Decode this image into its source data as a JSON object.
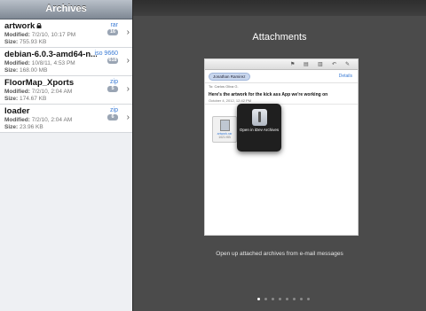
{
  "sidebar": {
    "title": "Archives",
    "items": [
      {
        "name": "artwork",
        "locked": true,
        "type": "rar",
        "badge": "16",
        "modified_label": "Modified:",
        "modified": "7/2/10, 10:17 PM",
        "size_label": "Size:",
        "size": "755.93 KB"
      },
      {
        "name": "debian-6.0.3-amd64-n...",
        "locked": false,
        "type": "iso 9660",
        "badge": "618",
        "modified_label": "Modified:",
        "modified": "10/8/11, 4:53 PM",
        "size_label": "Size:",
        "size": "168.00 MB"
      },
      {
        "name": "FloorMap_Xports",
        "locked": false,
        "type": "zip",
        "badge": "5",
        "modified_label": "Modified:",
        "modified": "7/2/10, 2:04 AM",
        "size_label": "Size:",
        "size": "174.67 KB"
      },
      {
        "name": "loader",
        "locked": false,
        "type": "zip",
        "badge": "6",
        "modified_label": "Modified:",
        "modified": "7/2/10, 2:04 AM",
        "size_label": "Size:",
        "size": "23.96 KB"
      }
    ]
  },
  "main": {
    "title": "Attachments",
    "caption": "Open up attached archives from e-mail messages",
    "page_count": 8,
    "current_page": 1
  },
  "email": {
    "recipient": "Jonathan Ramirez",
    "details": "Details",
    "cc": "To: Carlos Oliva G.",
    "subject": "Here's the artwork for the kick ass App we're working on",
    "date": "October 4, 2012, 12:42 PM",
    "attachment_name": "artwork.rar",
    "attachment_size": "1021 KB",
    "popover_label": "Open in iDev Archives"
  }
}
